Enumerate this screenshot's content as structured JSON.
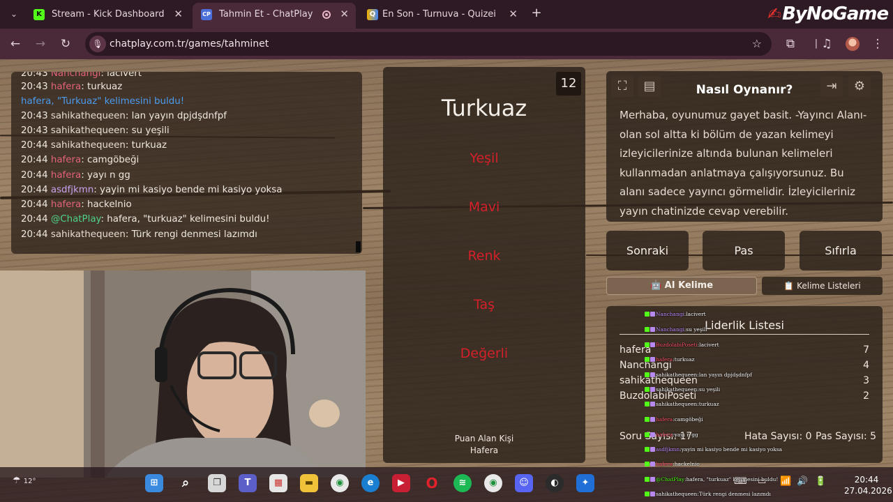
{
  "browser": {
    "tabs": [
      {
        "title": "Stream - Kick Dashboard",
        "favicon": "K"
      },
      {
        "title": "Tahmin Et - ChatPlay",
        "favicon": "CP"
      },
      {
        "title": "En Son - Turnuva - Quizei",
        "favicon": "Q"
      }
    ],
    "url": "chatplay.com.tr/games/tahminet",
    "brand": "ByNoGame"
  },
  "chat": {
    "lines": [
      {
        "time": "20:43",
        "user": "Nanchangi",
        "text": ": lacivert",
        "user_class": "user-pink"
      },
      {
        "time": "20:43",
        "user": "hafera",
        "text": ": turkuaz",
        "user_class": "user-pink"
      },
      {
        "system": "hafera, \"Turkuaz\" kelimesini buldu!"
      },
      {
        "time": "20:43",
        "user": "sahikathequeen",
        "text": ": lan yayın dpjdşdnfpf",
        "user_class": "user-light"
      },
      {
        "time": "20:43",
        "user": "sahikathequeen",
        "text": ": su yeşili",
        "user_class": "user-light"
      },
      {
        "time": "20:44",
        "user": "sahikathequeen",
        "text": ": turkuaz",
        "user_class": "user-light"
      },
      {
        "time": "20:44",
        "user": "hafera",
        "text": ": camgöbeği",
        "user_class": "user-pink"
      },
      {
        "time": "20:44",
        "user": "hafera",
        "text": ": yayı n gg",
        "user_class": "user-pink"
      },
      {
        "time": "20:44",
        "user": "asdfjkmn",
        "text": ": yayin mi kasiyo bende mi kasiyo yoksa",
        "user_class": "user-purple"
      },
      {
        "time": "20:44",
        "user": "hafera",
        "text": ": hackelnio",
        "user_class": "user-pink"
      },
      {
        "time": "20:44",
        "user": "@ChatPlay",
        "text": ": hafera, \"turkuaz\" kelimesini buldu!",
        "user_class": "user-green"
      },
      {
        "time": "20:44",
        "user": "sahikathequeen",
        "text": ": Türk rengi denmesi lazımdı",
        "user_class": "user-light"
      }
    ]
  },
  "game": {
    "counter": "12",
    "target_word": "Turkuaz",
    "forbidden_words": [
      "Yeşil",
      "Mavi",
      "Renk",
      "Taş",
      "Değerli"
    ],
    "scorer_label": "Puan Alan Kişi",
    "scorer_name": "Hafera"
  },
  "howto": {
    "title": "Nasıl Oynanır?",
    "description": "Merhaba, oyunumuz gayet basit. -Yayıncı Alanı- olan sol altta ki bölüm de yazan kelimeyi izleyicilerinize altında bulunan kelimeleri kullanmadan anlatmaya çalışıyorsunuz. Bu alanı sadece yayıncı görmelidir. İzleyicileriniz yayın chatinizde cevap verebilir."
  },
  "controls": {
    "next": "Sonraki",
    "pass": "Pas",
    "reset": "Sıfırla",
    "ai_word": "AI Kelime",
    "word_lists": "Kelime Listeleri"
  },
  "leaderboard": {
    "title": "Liderlik Listesi",
    "rows": [
      {
        "name": "hafera",
        "score": "7"
      },
      {
        "name": "Nanchangi",
        "score": "4"
      },
      {
        "name": "sahikathequeen",
        "score": "3"
      },
      {
        "name": "BuzdolabiPoseti",
        "score": "2"
      }
    ],
    "question_count": "Soru Sayısı: 17",
    "error_count": "Hata Sayısı: 0",
    "pass_count": "Pas Sayısı: 5"
  },
  "overlay": {
    "lines": [
      {
        "user": "Nanchangi",
        "text": "lacivert"
      },
      {
        "user": "Nanchangi",
        "text": "su yeşili"
      },
      {
        "user": "BuzdolabiPoseti",
        "text": "lacivert"
      },
      {
        "user": "hafera",
        "text": "turkuaz"
      },
      {
        "user": "sahikathequeen",
        "text": "lan yayın dpjdşdnfpf"
      },
      {
        "user": "sahikathequeen",
        "text": "su yeşili"
      },
      {
        "user": "sahikathequeen",
        "text": "turkuaz"
      },
      {
        "user": "hafera",
        "text": "camgöbeği"
      },
      {
        "user": "hafera",
        "text": "yayı n gg"
      },
      {
        "user": "asdfjkmn",
        "text": "yayin mi kasiyo bende mi kasiyo yoksa"
      },
      {
        "user": "hafera",
        "text": "hackelnio"
      },
      {
        "user": "@ChatPlay",
        "text": "hafera, \"turkuaz\" kelimesini buldu!"
      },
      {
        "user": "sahikathequeen",
        "text": "Türk rengi denmesi lazımdı"
      }
    ]
  },
  "taskbar": {
    "weather": "12°",
    "time": "20:44",
    "date": "27.04.2026"
  }
}
